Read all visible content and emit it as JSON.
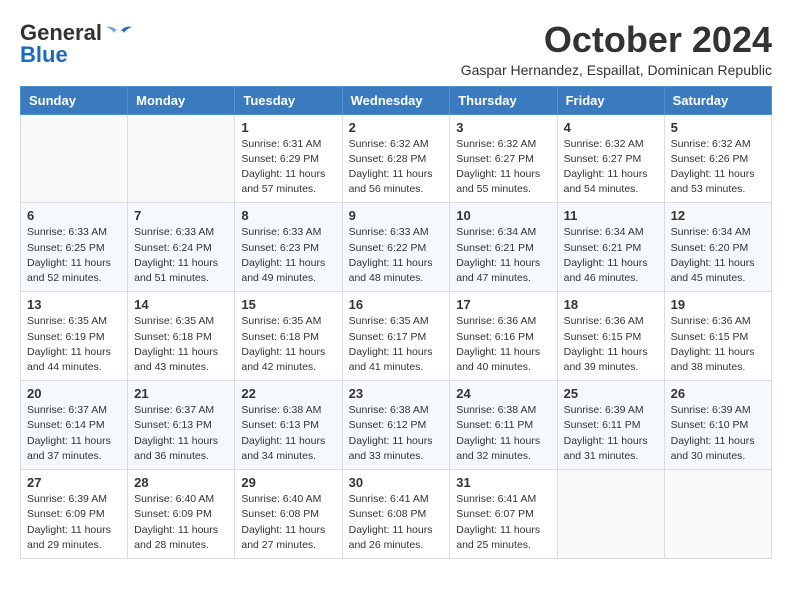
{
  "header": {
    "logo_general": "General",
    "logo_blue": "Blue",
    "month": "October 2024",
    "location": "Gaspar Hernandez, Espaillat, Dominican Republic"
  },
  "weekdays": [
    "Sunday",
    "Monday",
    "Tuesday",
    "Wednesday",
    "Thursday",
    "Friday",
    "Saturday"
  ],
  "weeks": [
    [
      {
        "day": "",
        "info": ""
      },
      {
        "day": "",
        "info": ""
      },
      {
        "day": "1",
        "sunrise": "6:31 AM",
        "sunset": "6:29 PM",
        "daylight": "11 hours and 57 minutes."
      },
      {
        "day": "2",
        "sunrise": "6:32 AM",
        "sunset": "6:28 PM",
        "daylight": "11 hours and 56 minutes."
      },
      {
        "day": "3",
        "sunrise": "6:32 AM",
        "sunset": "6:27 PM",
        "daylight": "11 hours and 55 minutes."
      },
      {
        "day": "4",
        "sunrise": "6:32 AM",
        "sunset": "6:27 PM",
        "daylight": "11 hours and 54 minutes."
      },
      {
        "day": "5",
        "sunrise": "6:32 AM",
        "sunset": "6:26 PM",
        "daylight": "11 hours and 53 minutes."
      }
    ],
    [
      {
        "day": "6",
        "sunrise": "6:33 AM",
        "sunset": "6:25 PM",
        "daylight": "11 hours and 52 minutes."
      },
      {
        "day": "7",
        "sunrise": "6:33 AM",
        "sunset": "6:24 PM",
        "daylight": "11 hours and 51 minutes."
      },
      {
        "day": "8",
        "sunrise": "6:33 AM",
        "sunset": "6:23 PM",
        "daylight": "11 hours and 49 minutes."
      },
      {
        "day": "9",
        "sunrise": "6:33 AM",
        "sunset": "6:22 PM",
        "daylight": "11 hours and 48 minutes."
      },
      {
        "day": "10",
        "sunrise": "6:34 AM",
        "sunset": "6:21 PM",
        "daylight": "11 hours and 47 minutes."
      },
      {
        "day": "11",
        "sunrise": "6:34 AM",
        "sunset": "6:21 PM",
        "daylight": "11 hours and 46 minutes."
      },
      {
        "day": "12",
        "sunrise": "6:34 AM",
        "sunset": "6:20 PM",
        "daylight": "11 hours and 45 minutes."
      }
    ],
    [
      {
        "day": "13",
        "sunrise": "6:35 AM",
        "sunset": "6:19 PM",
        "daylight": "11 hours and 44 minutes."
      },
      {
        "day": "14",
        "sunrise": "6:35 AM",
        "sunset": "6:18 PM",
        "daylight": "11 hours and 43 minutes."
      },
      {
        "day": "15",
        "sunrise": "6:35 AM",
        "sunset": "6:18 PM",
        "daylight": "11 hours and 42 minutes."
      },
      {
        "day": "16",
        "sunrise": "6:35 AM",
        "sunset": "6:17 PM",
        "daylight": "11 hours and 41 minutes."
      },
      {
        "day": "17",
        "sunrise": "6:36 AM",
        "sunset": "6:16 PM",
        "daylight": "11 hours and 40 minutes."
      },
      {
        "day": "18",
        "sunrise": "6:36 AM",
        "sunset": "6:15 PM",
        "daylight": "11 hours and 39 minutes."
      },
      {
        "day": "19",
        "sunrise": "6:36 AM",
        "sunset": "6:15 PM",
        "daylight": "11 hours and 38 minutes."
      }
    ],
    [
      {
        "day": "20",
        "sunrise": "6:37 AM",
        "sunset": "6:14 PM",
        "daylight": "11 hours and 37 minutes."
      },
      {
        "day": "21",
        "sunrise": "6:37 AM",
        "sunset": "6:13 PM",
        "daylight": "11 hours and 36 minutes."
      },
      {
        "day": "22",
        "sunrise": "6:38 AM",
        "sunset": "6:13 PM",
        "daylight": "11 hours and 34 minutes."
      },
      {
        "day": "23",
        "sunrise": "6:38 AM",
        "sunset": "6:12 PM",
        "daylight": "11 hours and 33 minutes."
      },
      {
        "day": "24",
        "sunrise": "6:38 AM",
        "sunset": "6:11 PM",
        "daylight": "11 hours and 32 minutes."
      },
      {
        "day": "25",
        "sunrise": "6:39 AM",
        "sunset": "6:11 PM",
        "daylight": "11 hours and 31 minutes."
      },
      {
        "day": "26",
        "sunrise": "6:39 AM",
        "sunset": "6:10 PM",
        "daylight": "11 hours and 30 minutes."
      }
    ],
    [
      {
        "day": "27",
        "sunrise": "6:39 AM",
        "sunset": "6:09 PM",
        "daylight": "11 hours and 29 minutes."
      },
      {
        "day": "28",
        "sunrise": "6:40 AM",
        "sunset": "6:09 PM",
        "daylight": "11 hours and 28 minutes."
      },
      {
        "day": "29",
        "sunrise": "6:40 AM",
        "sunset": "6:08 PM",
        "daylight": "11 hours and 27 minutes."
      },
      {
        "day": "30",
        "sunrise": "6:41 AM",
        "sunset": "6:08 PM",
        "daylight": "11 hours and 26 minutes."
      },
      {
        "day": "31",
        "sunrise": "6:41 AM",
        "sunset": "6:07 PM",
        "daylight": "11 hours and 25 minutes."
      },
      {
        "day": "",
        "info": ""
      },
      {
        "day": "",
        "info": ""
      }
    ]
  ],
  "labels": {
    "sunrise": "Sunrise:",
    "sunset": "Sunset:",
    "daylight": "Daylight:"
  }
}
